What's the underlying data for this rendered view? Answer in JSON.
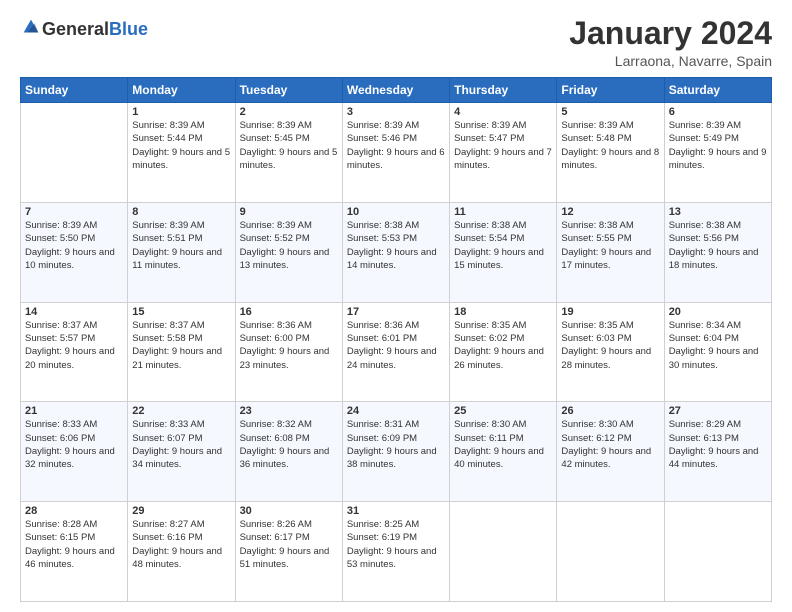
{
  "logo": {
    "general": "General",
    "blue": "Blue"
  },
  "title": "January 2024",
  "location": "Larraona, Navarre, Spain",
  "weekdays": [
    "Sunday",
    "Monday",
    "Tuesday",
    "Wednesday",
    "Thursday",
    "Friday",
    "Saturday"
  ],
  "weeks": [
    [
      {
        "day": "",
        "sunrise": "",
        "sunset": "",
        "daylight": ""
      },
      {
        "day": "1",
        "sunrise": "Sunrise: 8:39 AM",
        "sunset": "Sunset: 5:44 PM",
        "daylight": "Daylight: 9 hours and 5 minutes."
      },
      {
        "day": "2",
        "sunrise": "Sunrise: 8:39 AM",
        "sunset": "Sunset: 5:45 PM",
        "daylight": "Daylight: 9 hours and 5 minutes."
      },
      {
        "day": "3",
        "sunrise": "Sunrise: 8:39 AM",
        "sunset": "Sunset: 5:46 PM",
        "daylight": "Daylight: 9 hours and 6 minutes."
      },
      {
        "day": "4",
        "sunrise": "Sunrise: 8:39 AM",
        "sunset": "Sunset: 5:47 PM",
        "daylight": "Daylight: 9 hours and 7 minutes."
      },
      {
        "day": "5",
        "sunrise": "Sunrise: 8:39 AM",
        "sunset": "Sunset: 5:48 PM",
        "daylight": "Daylight: 9 hours and 8 minutes."
      },
      {
        "day": "6",
        "sunrise": "Sunrise: 8:39 AM",
        "sunset": "Sunset: 5:49 PM",
        "daylight": "Daylight: 9 hours and 9 minutes."
      }
    ],
    [
      {
        "day": "7",
        "sunrise": "Sunrise: 8:39 AM",
        "sunset": "Sunset: 5:50 PM",
        "daylight": "Daylight: 9 hours and 10 minutes."
      },
      {
        "day": "8",
        "sunrise": "Sunrise: 8:39 AM",
        "sunset": "Sunset: 5:51 PM",
        "daylight": "Daylight: 9 hours and 11 minutes."
      },
      {
        "day": "9",
        "sunrise": "Sunrise: 8:39 AM",
        "sunset": "Sunset: 5:52 PM",
        "daylight": "Daylight: 9 hours and 13 minutes."
      },
      {
        "day": "10",
        "sunrise": "Sunrise: 8:38 AM",
        "sunset": "Sunset: 5:53 PM",
        "daylight": "Daylight: 9 hours and 14 minutes."
      },
      {
        "day": "11",
        "sunrise": "Sunrise: 8:38 AM",
        "sunset": "Sunset: 5:54 PM",
        "daylight": "Daylight: 9 hours and 15 minutes."
      },
      {
        "day": "12",
        "sunrise": "Sunrise: 8:38 AM",
        "sunset": "Sunset: 5:55 PM",
        "daylight": "Daylight: 9 hours and 17 minutes."
      },
      {
        "day": "13",
        "sunrise": "Sunrise: 8:38 AM",
        "sunset": "Sunset: 5:56 PM",
        "daylight": "Daylight: 9 hours and 18 minutes."
      }
    ],
    [
      {
        "day": "14",
        "sunrise": "Sunrise: 8:37 AM",
        "sunset": "Sunset: 5:57 PM",
        "daylight": "Daylight: 9 hours and 20 minutes."
      },
      {
        "day": "15",
        "sunrise": "Sunrise: 8:37 AM",
        "sunset": "Sunset: 5:58 PM",
        "daylight": "Daylight: 9 hours and 21 minutes."
      },
      {
        "day": "16",
        "sunrise": "Sunrise: 8:36 AM",
        "sunset": "Sunset: 6:00 PM",
        "daylight": "Daylight: 9 hours and 23 minutes."
      },
      {
        "day": "17",
        "sunrise": "Sunrise: 8:36 AM",
        "sunset": "Sunset: 6:01 PM",
        "daylight": "Daylight: 9 hours and 24 minutes."
      },
      {
        "day": "18",
        "sunrise": "Sunrise: 8:35 AM",
        "sunset": "Sunset: 6:02 PM",
        "daylight": "Daylight: 9 hours and 26 minutes."
      },
      {
        "day": "19",
        "sunrise": "Sunrise: 8:35 AM",
        "sunset": "Sunset: 6:03 PM",
        "daylight": "Daylight: 9 hours and 28 minutes."
      },
      {
        "day": "20",
        "sunrise": "Sunrise: 8:34 AM",
        "sunset": "Sunset: 6:04 PM",
        "daylight": "Daylight: 9 hours and 30 minutes."
      }
    ],
    [
      {
        "day": "21",
        "sunrise": "Sunrise: 8:33 AM",
        "sunset": "Sunset: 6:06 PM",
        "daylight": "Daylight: 9 hours and 32 minutes."
      },
      {
        "day": "22",
        "sunrise": "Sunrise: 8:33 AM",
        "sunset": "Sunset: 6:07 PM",
        "daylight": "Daylight: 9 hours and 34 minutes."
      },
      {
        "day": "23",
        "sunrise": "Sunrise: 8:32 AM",
        "sunset": "Sunset: 6:08 PM",
        "daylight": "Daylight: 9 hours and 36 minutes."
      },
      {
        "day": "24",
        "sunrise": "Sunrise: 8:31 AM",
        "sunset": "Sunset: 6:09 PM",
        "daylight": "Daylight: 9 hours and 38 minutes."
      },
      {
        "day": "25",
        "sunrise": "Sunrise: 8:30 AM",
        "sunset": "Sunset: 6:11 PM",
        "daylight": "Daylight: 9 hours and 40 minutes."
      },
      {
        "day": "26",
        "sunrise": "Sunrise: 8:30 AM",
        "sunset": "Sunset: 6:12 PM",
        "daylight": "Daylight: 9 hours and 42 minutes."
      },
      {
        "day": "27",
        "sunrise": "Sunrise: 8:29 AM",
        "sunset": "Sunset: 6:13 PM",
        "daylight": "Daylight: 9 hours and 44 minutes."
      }
    ],
    [
      {
        "day": "28",
        "sunrise": "Sunrise: 8:28 AM",
        "sunset": "Sunset: 6:15 PM",
        "daylight": "Daylight: 9 hours and 46 minutes."
      },
      {
        "day": "29",
        "sunrise": "Sunrise: 8:27 AM",
        "sunset": "Sunset: 6:16 PM",
        "daylight": "Daylight: 9 hours and 48 minutes."
      },
      {
        "day": "30",
        "sunrise": "Sunrise: 8:26 AM",
        "sunset": "Sunset: 6:17 PM",
        "daylight": "Daylight: 9 hours and 51 minutes."
      },
      {
        "day": "31",
        "sunrise": "Sunrise: 8:25 AM",
        "sunset": "Sunset: 6:19 PM",
        "daylight": "Daylight: 9 hours and 53 minutes."
      },
      {
        "day": "",
        "sunrise": "",
        "sunset": "",
        "daylight": ""
      },
      {
        "day": "",
        "sunrise": "",
        "sunset": "",
        "daylight": ""
      },
      {
        "day": "",
        "sunrise": "",
        "sunset": "",
        "daylight": ""
      }
    ]
  ]
}
